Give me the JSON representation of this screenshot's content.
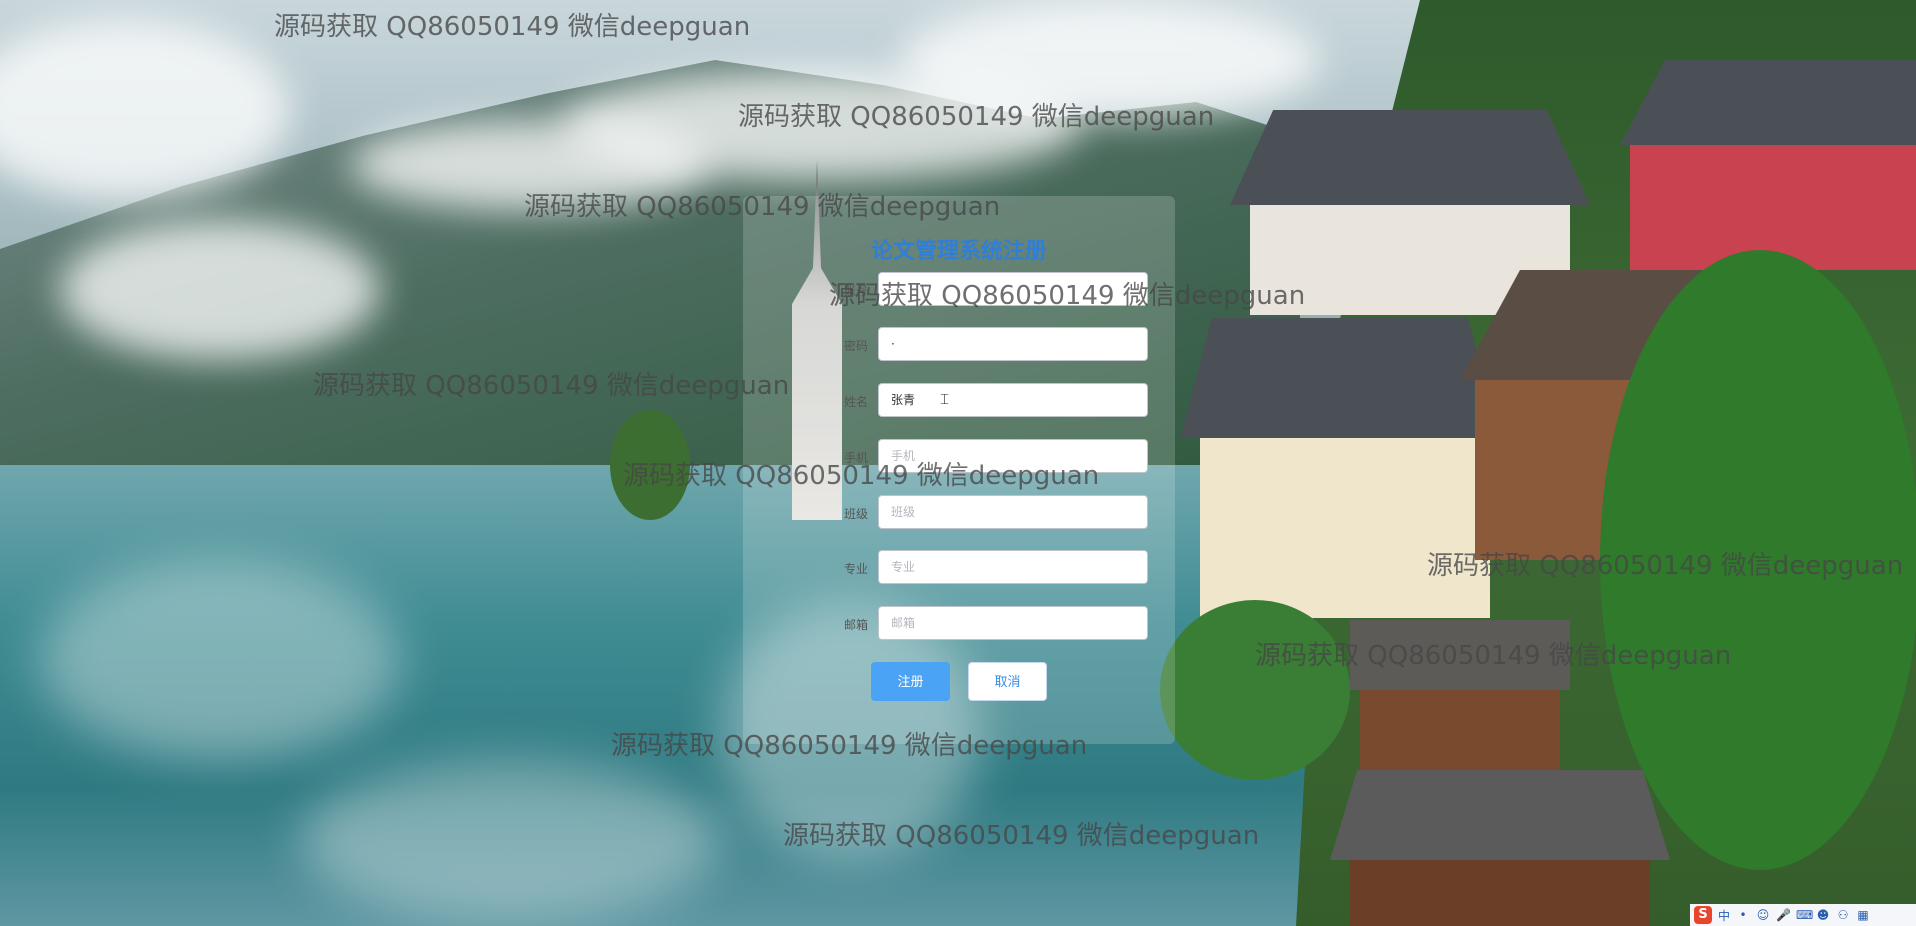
{
  "form": {
    "title": "论文管理系统注册",
    "fields": [
      {
        "key": "account",
        "label": "账号",
        "value": "",
        "placeholder": ""
      },
      {
        "key": "password",
        "label": "密码",
        "value": "·",
        "placeholder": ""
      },
      {
        "key": "name",
        "label": "姓名",
        "value": "张青",
        "placeholder": ""
      },
      {
        "key": "phone",
        "label": "手机",
        "value": "",
        "placeholder": "手机"
      },
      {
        "key": "class",
        "label": "班级",
        "value": "",
        "placeholder": "班级"
      },
      {
        "key": "major",
        "label": "专业",
        "value": "",
        "placeholder": "专业"
      },
      {
        "key": "email",
        "label": "邮箱",
        "value": "",
        "placeholder": "邮箱"
      }
    ],
    "register_label": "注册",
    "cancel_label": "取消"
  },
  "watermark": {
    "text": "源码获取 QQ86050149 微信deepguan"
  },
  "taskbar": {
    "logo": "S",
    "ime": "中",
    "icons": [
      "punctuation-icon",
      "emoji-icon",
      "mic-icon",
      "keyboard-icon",
      "user-icon",
      "shirt-icon",
      "apps-icon"
    ]
  },
  "colors": {
    "title": "#2f7fd8",
    "primary_button": "#4aa3f5",
    "panel": "rgba(255,255,255,0.18)"
  }
}
